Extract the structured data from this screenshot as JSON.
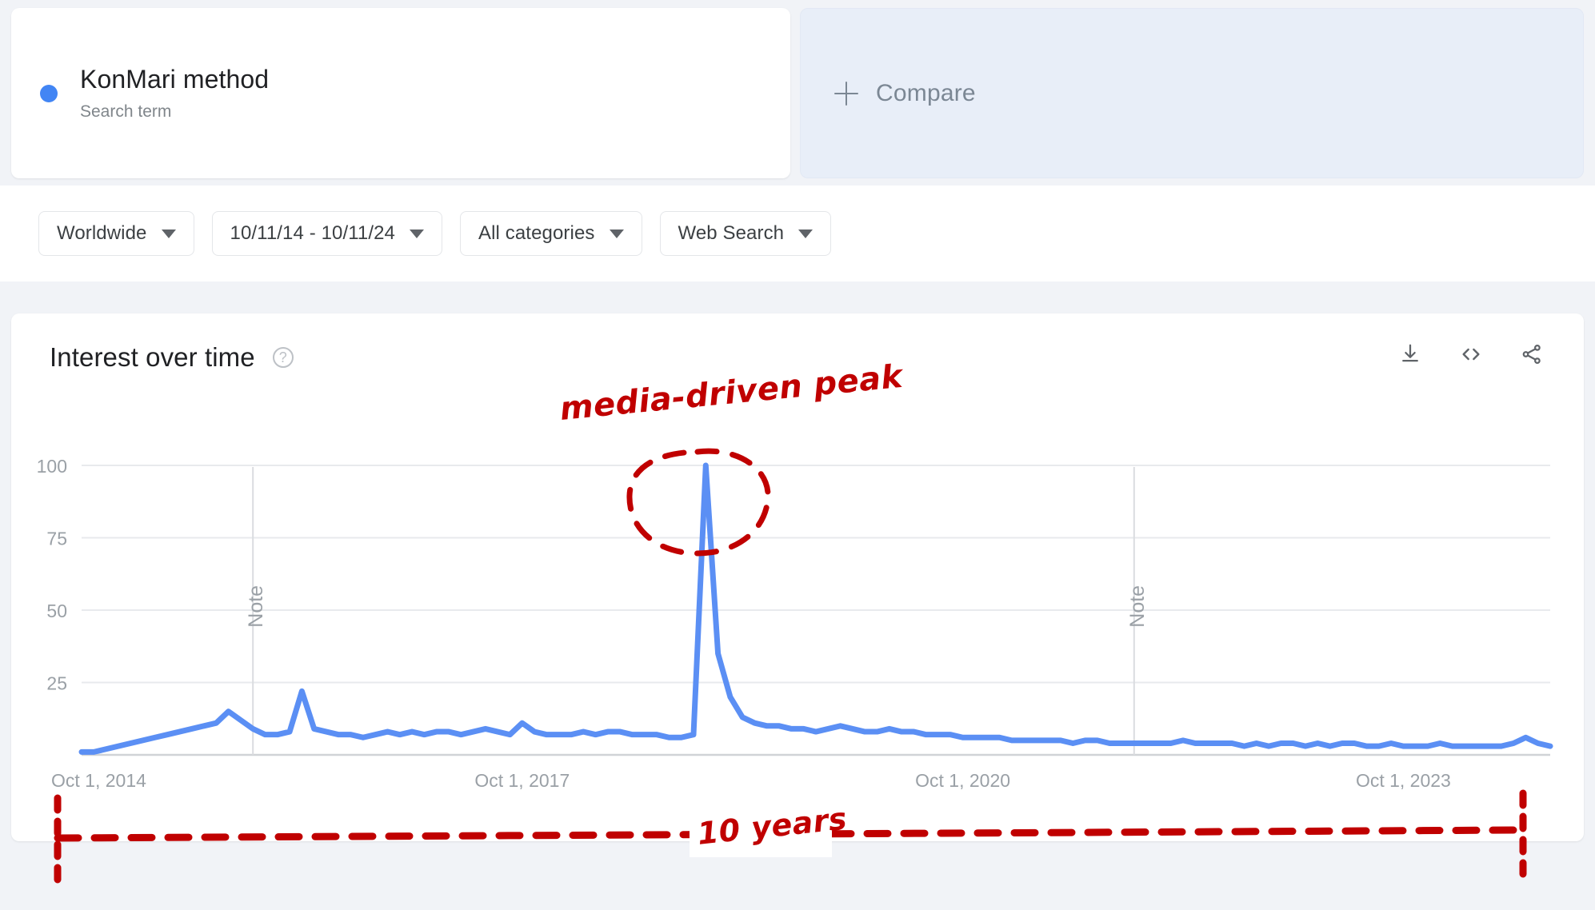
{
  "term": {
    "title": "KonMari method",
    "subtitle": "Search term",
    "dot_color": "#4285f4"
  },
  "compare": {
    "label": "Compare",
    "icon": "plus-icon"
  },
  "filters": [
    {
      "label": "Worldwide",
      "name": "region-filter"
    },
    {
      "label": "10/11/14 - 10/11/24",
      "name": "date-range-filter"
    },
    {
      "label": "All categories",
      "name": "category-filter"
    },
    {
      "label": "Web Search",
      "name": "search-type-filter"
    }
  ],
  "chart_card": {
    "title": "Interest over time",
    "help_icon": "help-circle-icon",
    "actions": [
      {
        "name": "download-icon"
      },
      {
        "name": "embed-code-icon"
      },
      {
        "name": "share-icon"
      }
    ]
  },
  "annotations": [
    {
      "name": "media-driven-peak-label",
      "text": "media-driven peak",
      "color": "#c00000"
    },
    {
      "name": "ten-years-span-label",
      "text": "10 years",
      "color": "#c00000"
    }
  ],
  "chart_data": {
    "type": "line",
    "title": "Interest over time",
    "xlabel": "",
    "ylabel": "",
    "ylim": [
      0,
      100
    ],
    "yticks": [
      25,
      50,
      75,
      100
    ],
    "xtick_labels": [
      "Oct 1, 2014",
      "Oct 1, 2017",
      "Oct 1, 2020",
      "Oct 1, 2023"
    ],
    "xtick_positions": [
      0,
      36,
      72,
      108
    ],
    "grid": true,
    "legend": false,
    "line_color": "#5b8ff4",
    "notes": [
      {
        "label": "Note",
        "x_index": 14
      },
      {
        "label": "Note",
        "x_index": 86
      }
    ],
    "series": [
      {
        "name": "KonMari method",
        "values": [
          1,
          1,
          2,
          3,
          4,
          5,
          6,
          7,
          8,
          9,
          10,
          11,
          15,
          12,
          9,
          7,
          7,
          8,
          22,
          9,
          8,
          7,
          7,
          6,
          7,
          8,
          7,
          8,
          7,
          8,
          8,
          7,
          8,
          9,
          8,
          7,
          11,
          8,
          7,
          7,
          7,
          8,
          7,
          8,
          8,
          7,
          7,
          7,
          6,
          6,
          7,
          100,
          35,
          20,
          13,
          11,
          10,
          10,
          9,
          9,
          8,
          9,
          10,
          9,
          8,
          8,
          9,
          8,
          8,
          7,
          7,
          7,
          6,
          6,
          6,
          6,
          5,
          5,
          5,
          5,
          5,
          4,
          5,
          5,
          4,
          4,
          4,
          4,
          4,
          4,
          5,
          4,
          4,
          4,
          4,
          3,
          4,
          3,
          4,
          4,
          3,
          4,
          3,
          4,
          4,
          3,
          3,
          4,
          3,
          3,
          3,
          4,
          3,
          3,
          3,
          3,
          3,
          4,
          6,
          4,
          3
        ]
      }
    ]
  }
}
